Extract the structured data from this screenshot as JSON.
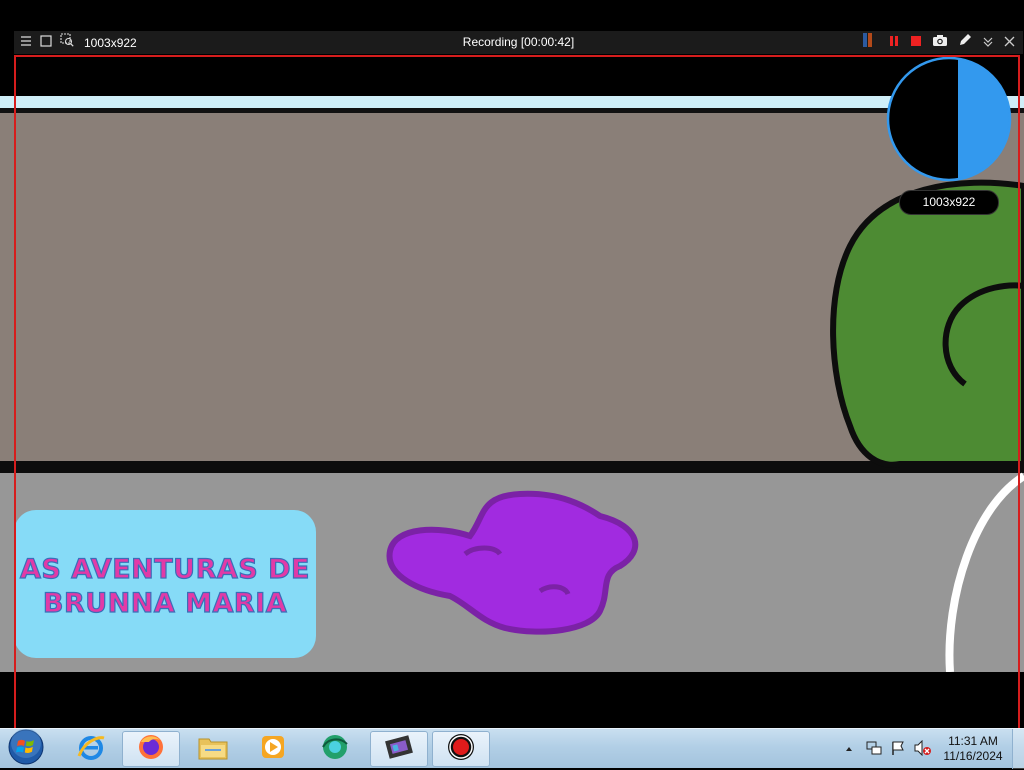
{
  "recorder": {
    "size_label": "1003x922",
    "title": "Recording [00:00:42]",
    "magnifier_size": "1003x922",
    "icons": {
      "menu": "menu-icon",
      "window": "window-select-icon",
      "region": "region-select-icon",
      "pause": "pause-icon",
      "stop": "stop-icon",
      "screenshot": "camera-icon",
      "draw": "pen-icon",
      "collapse": "chevron-down-icon",
      "close": "close-icon"
    }
  },
  "video": {
    "logo_line1": "AS AVENTURAS DE",
    "logo_line2": "BRUNNA MARIA"
  },
  "taskbar": {
    "apps": [
      {
        "name": "start-button",
        "icon": "windows-orb-icon"
      },
      {
        "name": "internet-explorer",
        "icon": "ie-icon"
      },
      {
        "name": "firefox",
        "icon": "firefox-icon"
      },
      {
        "name": "file-explorer",
        "icon": "folder-icon"
      },
      {
        "name": "media-player",
        "icon": "media-player-icon"
      },
      {
        "name": "photos-app",
        "icon": "photos-icon"
      },
      {
        "name": "movie-maker",
        "icon": "film-icon"
      },
      {
        "name": "screen-recorder",
        "icon": "record-icon"
      }
    ],
    "time": "11:31 AM",
    "date": "11/16/2024"
  },
  "colors": {
    "frame_border": "#d61d1d",
    "magnifier_accent": "#3399ee",
    "toolbar_bg": "#1b1b1b"
  }
}
